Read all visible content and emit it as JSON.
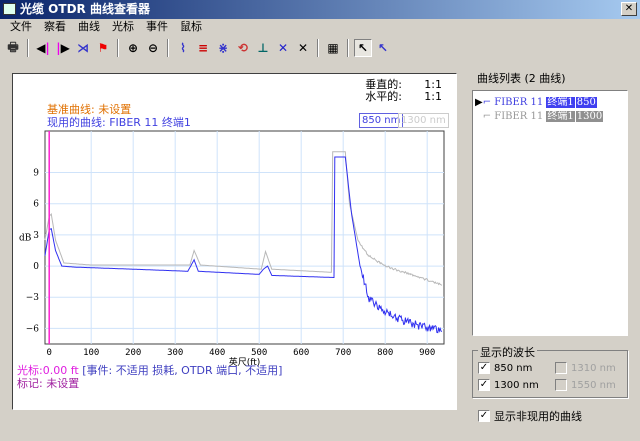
{
  "window": {
    "title": "光缆 OTDR 曲线查看器",
    "close": "✕"
  },
  "menu": [
    "文件",
    "察看",
    "曲线",
    "光标",
    "事件",
    "鼠标"
  ],
  "toolbar": [
    "printer-icon",
    "cursor-left-icon",
    "cursor-right-icon",
    "event-icon",
    "flag-icon",
    "zoom-in-icon",
    "zoom-out-icon",
    "trace-icon",
    "list-icon",
    "split-icon",
    "refresh-icon",
    "splice-icon",
    "x-blue-icon",
    "x-icon",
    "grid-icon",
    "select-icon",
    "select-alt-icon"
  ],
  "scale": {
    "vertical_label": "垂直的:",
    "vertical": "1:1",
    "horizontal_label": "水平的:",
    "horizontal": "1:1"
  },
  "reference": "基准曲线: 未设置",
  "current": "现用的曲线: FIBER 11 终端1",
  "wavelength_tabs": [
    "850 nm",
    "1300 nm"
  ],
  "cursor": {
    "label": "光标:",
    "value": "0.00 ft",
    "info": " [事件: 不适用 损耗, OTDR 端口, 不适用]"
  },
  "marker": "标记: 未设置",
  "chart_data": {
    "type": "line",
    "xlabel": "英尺(ft)",
    "ylabel": "dB",
    "xlim": [
      -10,
      940
    ],
    "ylim": [
      -7.5,
      13
    ],
    "xticks": [
      0,
      100,
      200,
      300,
      400,
      500,
      600,
      700,
      800,
      900
    ],
    "yticks": [
      9,
      6,
      3,
      0,
      -3,
      -6
    ],
    "series": [
      {
        "name": "FIBER 11 终端1 850",
        "color": "#3030f0",
        "points": [
          [
            -10,
            1
          ],
          [
            0,
            3.5
          ],
          [
            5,
            3.6
          ],
          [
            15,
            1.5
          ],
          [
            30,
            0
          ],
          [
            60,
            -0.1
          ],
          [
            200,
            -0.3
          ],
          [
            330,
            -0.5
          ],
          [
            345,
            0.6
          ],
          [
            355,
            -0.5
          ],
          [
            500,
            -0.8
          ],
          [
            510,
            -0.3
          ],
          [
            520,
            0
          ],
          [
            530,
            -0.9
          ],
          [
            678,
            -1.1
          ],
          [
            680,
            10.5
          ],
          [
            705,
            10.5
          ],
          [
            720,
            5
          ],
          [
            740,
            0
          ],
          [
            760,
            -3
          ],
          [
            800,
            -4.5
          ],
          [
            860,
            -5.5
          ],
          [
            935,
            -6.3
          ]
        ]
      },
      {
        "name": "FIBER 11 终端1 1300",
        "color": "#b8b8b8",
        "points": [
          [
            -10,
            2.5
          ],
          [
            0,
            4.8
          ],
          [
            5,
            5
          ],
          [
            15,
            2.5
          ],
          [
            35,
            0.3
          ],
          [
            100,
            0.1
          ],
          [
            335,
            0.1
          ],
          [
            345,
            1.5
          ],
          [
            360,
            0.1
          ],
          [
            505,
            -0.3
          ],
          [
            515,
            1.4
          ],
          [
            530,
            -0.3
          ],
          [
            672,
            -0.6
          ],
          [
            675,
            11
          ],
          [
            705,
            11
          ],
          [
            715,
            6
          ],
          [
            735,
            2.5
          ],
          [
            760,
            1
          ],
          [
            800,
            0
          ],
          [
            860,
            -0.8
          ],
          [
            935,
            -1.8
          ]
        ]
      }
    ]
  },
  "right": {
    "list_title": "曲线列表 (2 曲线)",
    "items": [
      {
        "name": "FIBER 11 ",
        "end": "终端1",
        "wl": "850"
      },
      {
        "name": "FIBER 11 ",
        "end": "终端1",
        "wl": "1300"
      }
    ],
    "group_title": "显示的波长",
    "wavelengths": [
      {
        "label": "850 nm",
        "checked": true
      },
      {
        "label": "1300 nm",
        "checked": true
      },
      {
        "label": "1310 nm",
        "checked": false
      },
      {
        "label": "1550 nm",
        "checked": false
      }
    ],
    "show_inactive": "显示非现用的曲线"
  },
  "check": "✓"
}
